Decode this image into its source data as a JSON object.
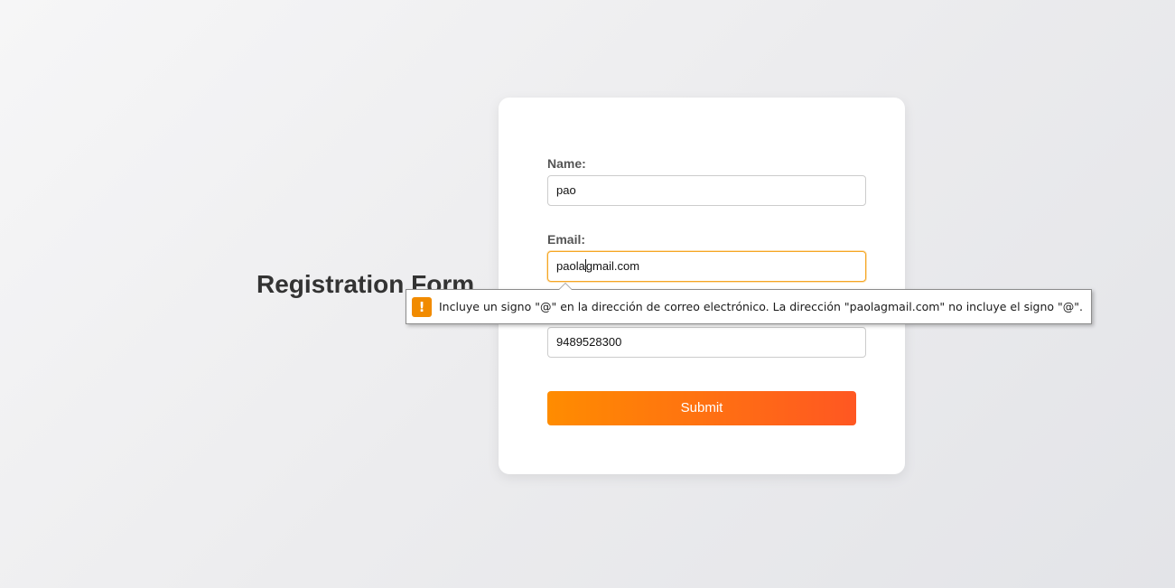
{
  "page": {
    "title": "Registration Form"
  },
  "form": {
    "name_label": "Name:",
    "name_value": "pao",
    "email_label": "Email:",
    "email_value_before_caret": "paola",
    "email_value_after_caret": "gmail.com",
    "phone_value": "9489528300",
    "submit_label": "Submit"
  },
  "validation": {
    "icon": "warning-icon",
    "message": "Incluye un signo \"@\" en la dirección de correo electrónico. La dirección \"paolagmail.com\" no incluye el signo \"@\"."
  },
  "colors": {
    "accent_start": "#ff8c00",
    "accent_end": "#ff5722",
    "focus_border": "#f5a623",
    "warning": "#f18b00"
  }
}
